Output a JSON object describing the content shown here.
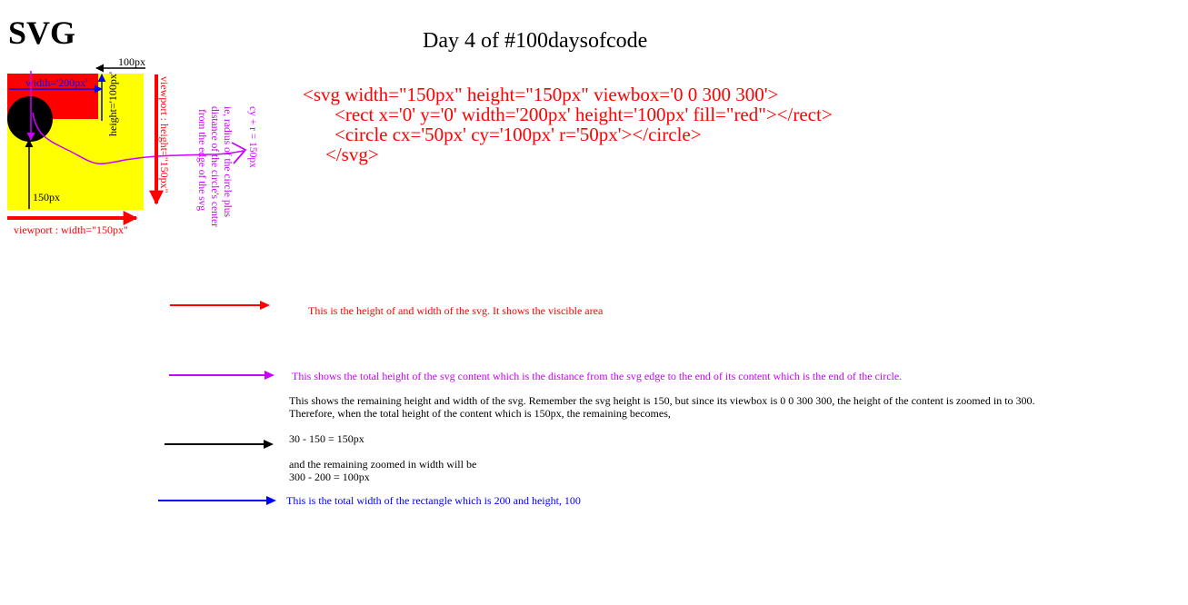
{
  "header": {
    "logo_text": "SVG",
    "title": "Day 4 of #100daysofcode"
  },
  "code": {
    "line1": "<svg width=\"150px\" height=\"150px\" viewbox='0 0 300 300'>",
    "line2": "<rect x='0' y='0' width='200px' height='100px' fill=\"red\"></rect>",
    "line3": "<circle cx='50px' cy='100px' r='50px'></circle>",
    "line4": "</svg>"
  },
  "diagram": {
    "label_100px": "100px",
    "label_width_200": "width='200px'",
    "label_height_100": "height='100px'",
    "label_150px": "150px",
    "label_viewport_width": "viewport : width=\"150px\"",
    "label_viewport_height": "viewport : height=\"150px\"",
    "label_radius_1": "ie, radius of the circle plus",
    "label_radius_2": "distance of the circle's center",
    "label_radius_3": "from the edge of the svg",
    "label_cy_r": "cy + r = 150px",
    "colors": {
      "viewport": "#ffff00",
      "rect": "#ff0000",
      "circle": "#000000",
      "red_arrow": "#ff0000",
      "magenta_arrow": "#cc00ff",
      "blue_arrow": "#0000ff",
      "black_arrow": "#000000"
    }
  },
  "legend": {
    "red": "This is the height of and width of the svg. It shows the viscible area",
    "magenta": "This shows the total height of the svg content which is the distance from the svg edge to the end of its content which is the end of the circle.",
    "black_line1": "This shows the remaining  height and width of the svg. Remember the svg height is 150, but since its viewbox is 0 0 300 300, the height of the content is zoomed in to 300.",
    "black_line2": "Therefore, when the total height of the content which is 150px, the remaining becomes,",
    "black_calc1": "30 - 150 = 150px",
    "black_line3": "and the remaining zoomed in width will be",
    "black_calc2": "300 - 200 = 100px",
    "blue": "This is the total width of the rectangle which is 200 and height, 100"
  }
}
